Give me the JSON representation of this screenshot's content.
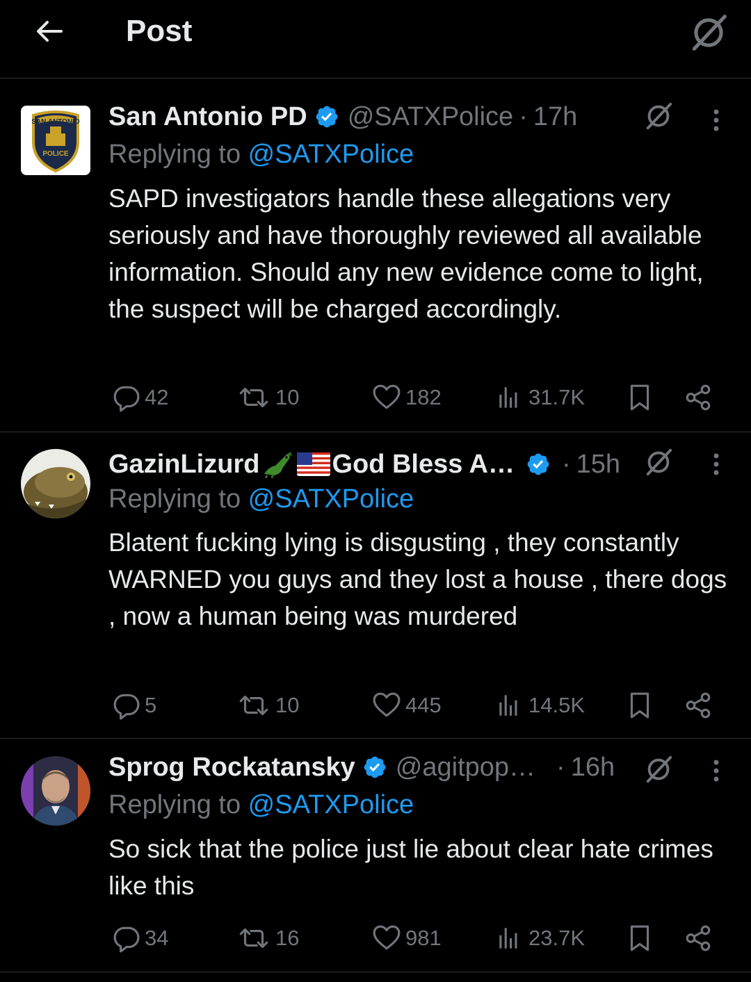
{
  "header": {
    "title": "Post"
  },
  "tweets": [
    {
      "name": "San Antonio PD",
      "handle": "@SATXPolice",
      "sep": "·",
      "time": "17h",
      "replying_prefix": "Replying to ",
      "replying_to": "@SATXPolice",
      "text": "SAPD investigators handle these allegations very seriously and have thoroughly reviewed all available information. Should any new evidence come to light, the suspect will be charged accordingly.",
      "replies": "42",
      "reposts": "10",
      "likes": "182",
      "views": "31.7K",
      "avatar_badge_top": "SAN ANTONIO",
      "avatar_badge_bottom": "POLICE"
    },
    {
      "name": "GazinLizurd",
      "name_suffix": "God Bless A…",
      "sep": "·",
      "time": "15h",
      "replying_prefix": "Replying to ",
      "replying_to": "@SATXPolice",
      "text": "Blatent fucking lying is disgusting , they constantly WARNED you guys and they lost a house , there dogs , now a human being was murdered",
      "replies": "5",
      "reposts": "10",
      "likes": "445",
      "views": "14.5K"
    },
    {
      "name": "Sprog Rockatansky",
      "handle": "@agitpop…",
      "sep": "·",
      "time": "16h",
      "replying_prefix": "Replying to ",
      "replying_to": "@SATXPolice",
      "text": "So sick that the police just lie about clear hate crimes like this",
      "replies": "34",
      "reposts": "16",
      "likes": "981",
      "views": "23.7K"
    }
  ],
  "colors": {
    "accent": "#1d9bf0",
    "muted": "#71767b",
    "text": "#e7e9ea",
    "border": "#2f3336"
  },
  "icons": [
    "back-arrow-icon",
    "grok-icon",
    "verified-badge-icon",
    "more-icon",
    "reply-icon",
    "repost-icon",
    "like-icon",
    "views-icon",
    "bookmark-icon",
    "share-icon",
    "alligator-emoji",
    "us-flag-emoji"
  ]
}
